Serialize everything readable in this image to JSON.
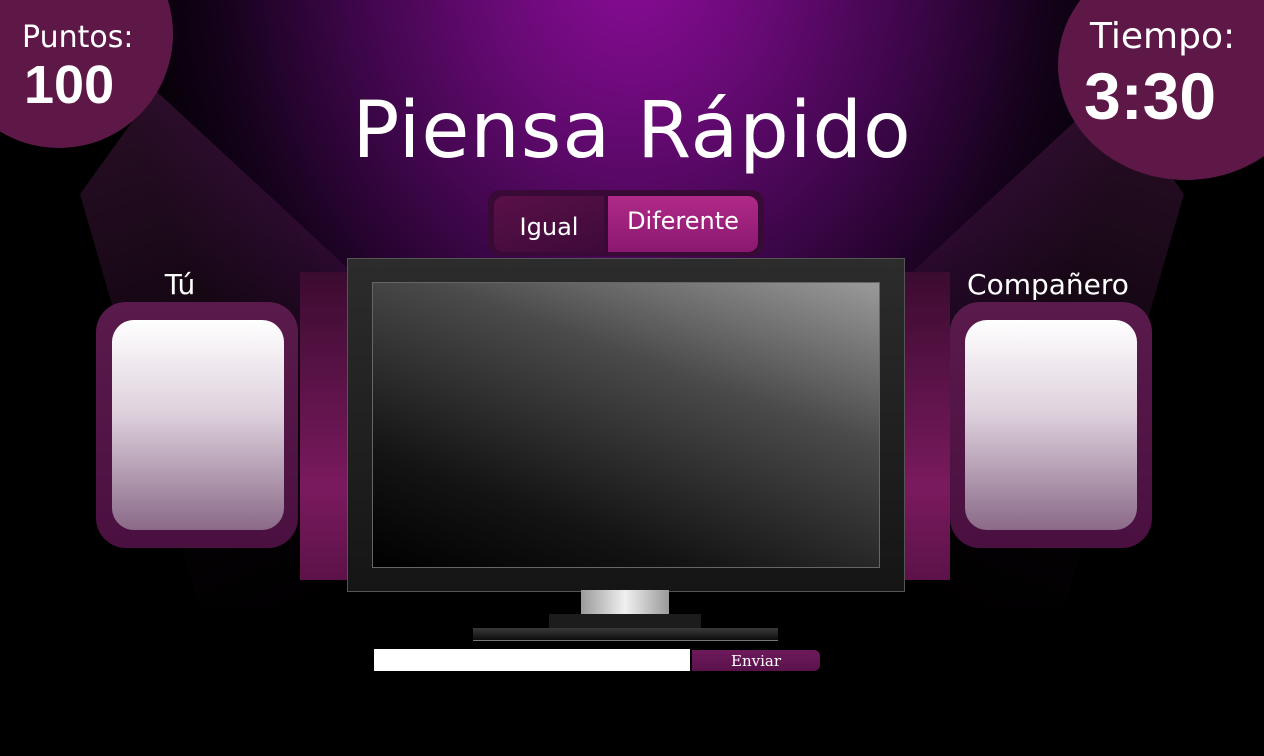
{
  "score": {
    "label": "Puntos:",
    "value": "100"
  },
  "timer": {
    "label": "Tiempo:",
    "value": "3:30"
  },
  "title": "Piensa Rápido",
  "toggle": {
    "same_label": "Igual",
    "different_label": "Diferente",
    "selected": "Diferente"
  },
  "players": {
    "you_label": "Tú",
    "partner_label": "Compañero"
  },
  "answer": {
    "value": "",
    "send_label": "Enviar"
  },
  "colors": {
    "accent": "#8a0c96",
    "panel": "#5e1848",
    "button_active": "#b02a88"
  }
}
